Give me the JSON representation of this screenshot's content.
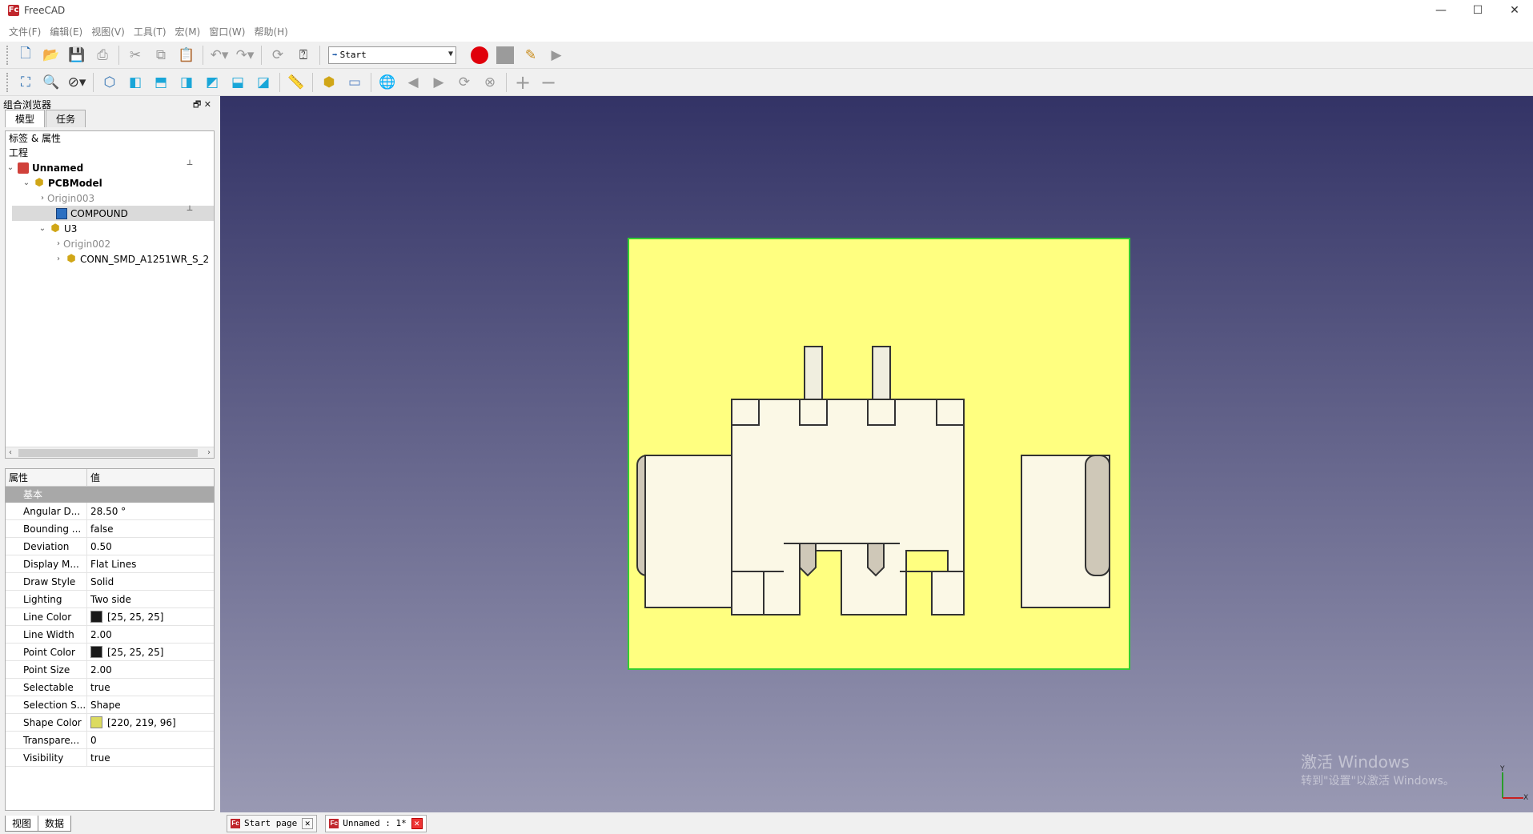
{
  "window": {
    "title": "FreeCAD",
    "app_icon": "Fc",
    "controls": {
      "minimize": "—",
      "maximize": "☐",
      "close": "✕"
    }
  },
  "menu": [
    "文件(F)",
    "编辑(E)",
    "视图(V)",
    "工具(T)",
    "宏(M)",
    "窗口(W)",
    "帮助(H)"
  ],
  "workbench": {
    "selected": "Start"
  },
  "panel": {
    "title": "组合浏览器",
    "tabs": [
      "模型",
      "任务"
    ],
    "tree_header": "标签 & 属性",
    "section": "工程",
    "tree": [
      {
        "label": "Unnamed",
        "level": 0,
        "expand": "⌄",
        "icon": "document-icon"
      },
      {
        "label": "PCBModel",
        "level": 1,
        "expand": "⌄",
        "icon": "part-icon"
      },
      {
        "label": "Origin003",
        "level": 2,
        "expand": "›",
        "icon": "origin-icon"
      },
      {
        "label": "COMPOUND",
        "level": 2,
        "expand": "",
        "icon": "compound-icon"
      },
      {
        "label": "U3",
        "level": 2,
        "expand": "⌄",
        "icon": "part-icon"
      },
      {
        "label": "Origin002",
        "level": 3,
        "expand": "›",
        "icon": "origin-icon"
      },
      {
        "label": "CONN_SMD_A1251WR_S_2",
        "level": 3,
        "expand": "›",
        "icon": "part-icon"
      }
    ]
  },
  "properties": {
    "col_name": "属性",
    "col_value": "值",
    "group": "基本",
    "rows": [
      {
        "name": "Angular D...",
        "value": "28.50 °"
      },
      {
        "name": "Bounding ...",
        "value": "false"
      },
      {
        "name": "Deviation",
        "value": "0.50"
      },
      {
        "name": "Display M...",
        "value": "Flat Lines"
      },
      {
        "name": "Draw Style",
        "value": "Solid"
      },
      {
        "name": "Lighting",
        "value": "Two side"
      },
      {
        "name": "Line Color",
        "value": "[25, 25, 25]",
        "swatch": "#191919"
      },
      {
        "name": "Line Width",
        "value": "2.00"
      },
      {
        "name": "Point Color",
        "value": "[25, 25, 25]",
        "swatch": "#191919"
      },
      {
        "name": "Point Size",
        "value": "2.00"
      },
      {
        "name": "Selectable",
        "value": "true"
      },
      {
        "name": "Selection S...",
        "value": "Shape"
      },
      {
        "name": "Shape Color",
        "value": "[220, 219, 96]",
        "swatch": "#dcdb60"
      },
      {
        "name": "Transpare...",
        "value": "0"
      },
      {
        "name": "Visibility",
        "value": "true"
      }
    ]
  },
  "bottom_tabs": [
    "视图",
    "数据"
  ],
  "doc_tabs": [
    {
      "label": "Start page"
    },
    {
      "label": "Unnamed : 1*"
    }
  ],
  "watermark": {
    "line1": "激活 Windows",
    "line2": "转到\"设置\"以激活 Windows。"
  },
  "axis": {
    "y": "Y",
    "x": "X"
  },
  "colors": {
    "board": "#ffff80",
    "board_border": "#33cc33",
    "component": "#fbf8e6",
    "record": "#e0000b"
  }
}
